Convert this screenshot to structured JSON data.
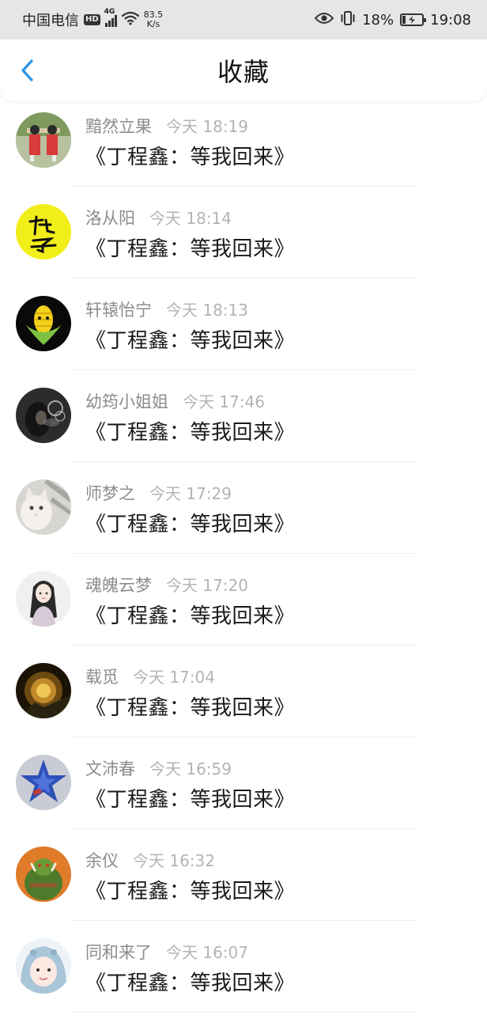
{
  "status_bar": {
    "carrier": "中国电信",
    "hd": "HD",
    "network_gen": "4G",
    "speed_value": "83.5",
    "speed_unit": "K/s",
    "battery": "18%",
    "battery_level": 0.18,
    "time": "19:08"
  },
  "header": {
    "title": "收藏",
    "back_icon": "chevron-left-icon",
    "accent_color": "#2d95e8"
  },
  "items": [
    {
      "user": "黯然立果",
      "time": "今天 18:19",
      "message": "《丁程鑫：等我回来》",
      "avatar": "avatar-two-figures"
    },
    {
      "user": "洛从阳",
      "time": "今天 18:14",
      "message": "《丁程鑫：等我回来》",
      "avatar": "avatar-yellow-calligraphy"
    },
    {
      "user": "轩辕怡宁",
      "time": "今天 18:13",
      "message": "《丁程鑫：等我回来》",
      "avatar": "avatar-corn"
    },
    {
      "user": "幼筠小姐姐",
      "time": "今天 17:46",
      "message": "《丁程鑫：等我回来》",
      "avatar": "avatar-dark-smoke"
    },
    {
      "user": "师梦之",
      "time": "今天 17:29",
      "message": "《丁程鑫：等我回来》",
      "avatar": "avatar-cat"
    },
    {
      "user": "魂魄云梦",
      "time": "今天 17:20",
      "message": "《丁程鑫：等我回来》",
      "avatar": "avatar-anime-girl"
    },
    {
      "user": "载觅",
      "time": "今天 17:04",
      "message": "《丁程鑫：等我回来》",
      "avatar": "avatar-dark-interior"
    },
    {
      "user": "文沛春",
      "time": "今天 16:59",
      "message": "《丁程鑫：等我回来》",
      "avatar": "avatar-blue-star"
    },
    {
      "user": "余仪",
      "time": "今天 16:32",
      "message": "《丁程鑫：等我回来》",
      "avatar": "avatar-orc"
    },
    {
      "user": "同和来了",
      "time": "今天 16:07",
      "message": "《丁程鑫：等我回来》",
      "avatar": "avatar-girl-hood"
    }
  ]
}
